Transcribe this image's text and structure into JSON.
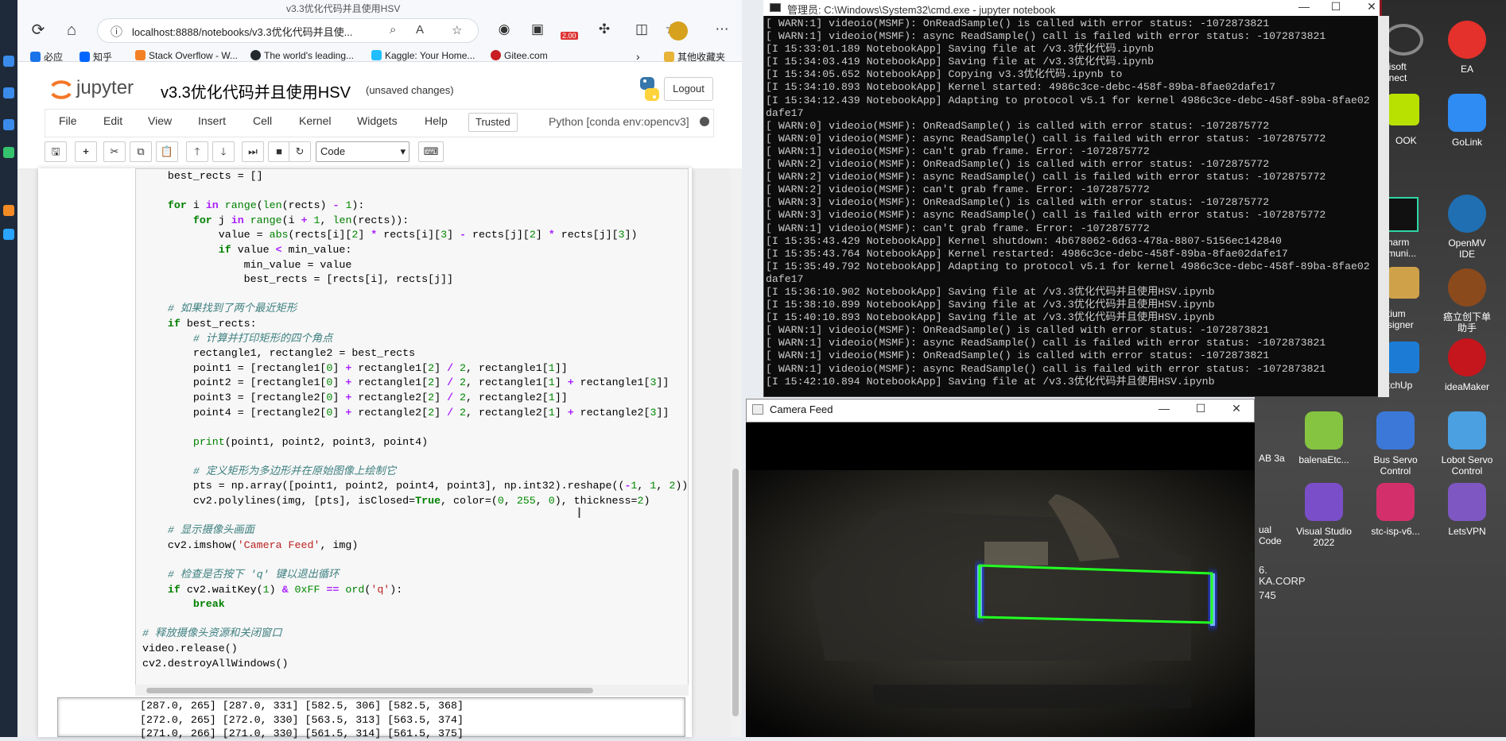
{
  "browser": {
    "tab_title": "v3.3优化代码并且使用HSV",
    "url": "localhost:8888/notebooks/v3.3优化代码并且使...",
    "badge": "2.00",
    "bookmarks": [
      {
        "label": "必应",
        "color": "#1a73e8"
      },
      {
        "label": "知乎",
        "color": "#0066ff"
      },
      {
        "label": "Stack Overflow - W...",
        "color": "#f48024"
      },
      {
        "label": "The world's leading...",
        "color": "#24292e"
      },
      {
        "label": "Kaggle: Your Home...",
        "color": "#20beff"
      },
      {
        "label": "Gitee.com",
        "color": "#c71d23"
      }
    ],
    "other_bookmarks": "其他收藏夹"
  },
  "jupyter": {
    "logo": "jupyter",
    "notebook_name": "v3.3优化代码并且使用HSV",
    "unsaved": "(unsaved changes)",
    "logout": "Logout",
    "menu": [
      "File",
      "Edit",
      "View",
      "Insert",
      "Cell",
      "Kernel",
      "Widgets",
      "Help"
    ],
    "trusted": "Trusted",
    "kernel": "Python [conda env:opencv3]",
    "cell_type": "Code"
  },
  "output_lines": [
    "[287.0, 265] [287.0, 331] [582.5, 306] [582.5, 368]",
    "[272.0, 265] [272.0, 330] [563.5, 313] [563.5, 374]",
    "[271.0, 266] [271.0, 330] [561.5, 314] [561.5, 375]"
  ],
  "cmd": {
    "title": "管理员: C:\\Windows\\System32\\cmd.exe - jupyter  notebook",
    "lines": [
      "[ WARN:1] videoio(MSMF): OnReadSample() is called with error status: -1072873821",
      "[ WARN:1] videoio(MSMF): async ReadSample() call is failed with error status: -1072873821",
      "[I 15:33:01.189 NotebookApp] Saving file at /v3.3优化代码.ipynb",
      "[I 15:34:03.419 NotebookApp] Saving file at /v3.3优化代码.ipynb",
      "[I 15:34:05.652 NotebookApp] Copying v3.3优化代码.ipynb to",
      "[I 15:34:10.893 NotebookApp] Kernel started: 4986c3ce-debc-458f-89ba-8fae02dafe17",
      "[I 15:34:12.439 NotebookApp] Adapting to protocol v5.1 for kernel 4986c3ce-debc-458f-89ba-8fae02",
      "dafe17",
      "[ WARN:0] videoio(MSMF): OnReadSample() is called with error status: -1072875772",
      "[ WARN:0] videoio(MSMF): async ReadSample() call is failed with error status: -1072875772",
      "[ WARN:1] videoio(MSMF): can't grab frame. Error: -1072875772",
      "[ WARN:2] videoio(MSMF): OnReadSample() is called with error status: -1072875772",
      "[ WARN:2] videoio(MSMF): async ReadSample() call is failed with error status: -1072875772",
      "[ WARN:2] videoio(MSMF): can't grab frame. Error: -1072875772",
      "[ WARN:3] videoio(MSMF): OnReadSample() is called with error status: -1072875772",
      "[ WARN:3] videoio(MSMF): async ReadSample() call is failed with error status: -1072875772",
      "[ WARN:1] videoio(MSMF): can't grab frame. Error: -1072875772",
      "[I 15:35:43.429 NotebookApp] Kernel shutdown: 4b678062-6d63-478a-8807-5156ec142840",
      "[I 15:35:43.764 NotebookApp] Kernel restarted: 4986c3ce-debc-458f-89ba-8fae02dafe17",
      "[I 15:35:49.792 NotebookApp] Adapting to protocol v5.1 for kernel 4986c3ce-debc-458f-89ba-8fae02",
      "dafe17",
      "[I 15:36:10.902 NotebookApp] Saving file at /v3.3优化代码并且使用HSV.ipynb",
      "[I 15:38:10.899 NotebookApp] Saving file at /v3.3优化代码并且使用HSV.ipynb",
      "[I 15:40:10.893 NotebookApp] Saving file at /v3.3优化代码并且使用HSV.ipynb",
      "[ WARN:1] videoio(MSMF): OnReadSample() is called with error status: -1072873821",
      "[ WARN:1] videoio(MSMF): async ReadSample() call is failed with error status: -1072873821",
      "[ WARN:1] videoio(MSMF): OnReadSample() is called with error status: -1072873821",
      "[ WARN:1] videoio(MSMF): async ReadSample() call is failed with error status: -1072873821",
      "[I 15:42:10.894 NotebookApp] Saving file at /v3.3优化代码并且使用HSV.ipynb"
    ]
  },
  "camera": {
    "title": "Camera Feed"
  },
  "desktop": {
    "icons": [
      {
        "label": "EA",
        "color": "#e4312b"
      },
      {
        "label": "GoLink",
        "color": "#2f8cf3"
      },
      {
        "label": "OpenMV IDE",
        "color": "#1f6fb2"
      },
      {
        "label": "癌立创下单助手",
        "color": "#8b4a1c"
      },
      {
        "label": "ideaMaker",
        "color": "#c4161c"
      },
      {
        "label": "balenaEtc...",
        "color": "#85c440"
      },
      {
        "label": "Bus Servo Control",
        "color": "#3c78d8"
      },
      {
        "label": "Lobot Servo Control",
        "color": "#4aa0e0"
      },
      {
        "label": "Visual Studio 2022",
        "color": "#7b4ec9"
      },
      {
        "label": "stc-isp-v6...",
        "color": "#d3306b"
      },
      {
        "label": "LetsVPN",
        "color": "#7e57c2"
      }
    ],
    "partial_labels": [
      "bisoft nnect",
      "OOK",
      "harm muni...",
      "tium signer",
      "tchUp",
      "AB 3a",
      "ual Code",
      "6.",
      "KA.CORP",
      "745"
    ]
  }
}
